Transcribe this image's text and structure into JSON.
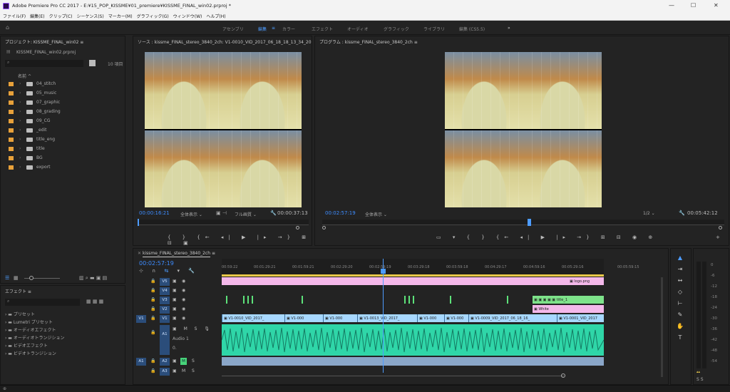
{
  "window": {
    "title": "Adobe Premiere Pro CC 2017 - E:¥15_POP_KISSME¥01_premiere¥KISSME_FINAL_win02.prproj *"
  },
  "menu": [
    "ファイル(F)",
    "編集(E)",
    "クリップ(C)",
    "シーケンス(S)",
    "マーカー(M)",
    "グラフィック(G)",
    "ウィンドウ(W)",
    "ヘルプ(H)"
  ],
  "workspaces": [
    "アセンブリ",
    "編集",
    "カラー",
    "エフェクト",
    "オーディオ",
    "グラフィック",
    "ライブラリ",
    "編集 (CS5.5)"
  ],
  "project": {
    "title": "プロジェクト: KISSME_FINAL_win02",
    "file": "KISSME_FINAL_win02.prproj",
    "count": "10 項目",
    "name_col": "名前",
    "bins": [
      "04_stitch",
      "05_music",
      "07_graphic",
      "08_grading",
      "09_CG",
      "_edit",
      "title_eng",
      "title",
      "BG",
      "export"
    ]
  },
  "effects": {
    "title": "エフェクト",
    "items": [
      "プリセット",
      "Lumetri プリセット",
      "オーディオエフェクト",
      "オーディオトランジション",
      "ビデオエフェクト",
      "ビデオトランジション"
    ]
  },
  "source": {
    "title": "ソース : kissme_FINAL_stereo_3840_2ch: V1-0010_VID_2017_06_18_18_13_34_2017",
    "tc_left": "00:00:16:21",
    "fit": "全体表示",
    "quality": "フル画質",
    "tc_right": "00:00:37:13"
  },
  "program": {
    "title": "プログラム : kissme_FINAL_stereo_3840_2ch",
    "tc_left": "00:02:57:19",
    "fit": "全体表示",
    "ratio": "1/2",
    "tc_right": "00:05:42:12"
  },
  "timeline": {
    "tab": "kissme_FINAL_stereo_3840_2ch",
    "tc": "00:02:57:19",
    "ruler": [
      "00:59:22",
      "00:01:29:21",
      "00:01:59:21",
      "00:02:29:20",
      "00:02:59:19",
      "00:03:29:18",
      "00:03:59:18",
      "00:04:29:17",
      "00:04:59:16",
      "00:05:29:16",
      "00:05:59:15"
    ],
    "tracks": [
      "V5",
      "V4",
      "V3",
      "V2",
      "V1",
      "A1",
      "A2",
      "A3"
    ],
    "audio_name": "Audio 1",
    "audio_val": "0.",
    "v5_clip": "logo.png",
    "v3_clip": "title_1",
    "v2_clip": "White",
    "v1_clips": [
      "V1-0010_VID_2017_",
      "V1-000",
      "V1-000",
      "V1-0013_VID_2017_",
      "V1-000",
      "V1-000",
      "V1-0009_VID_2017_06_18_16_",
      "V1-0001_VID_2017"
    ]
  },
  "meter": [
    "0",
    "-6",
    "-12",
    "-18",
    "-24",
    "-30",
    "-36",
    "-42",
    "-48",
    "-54"
  ],
  "meter_bottom": "S  S"
}
